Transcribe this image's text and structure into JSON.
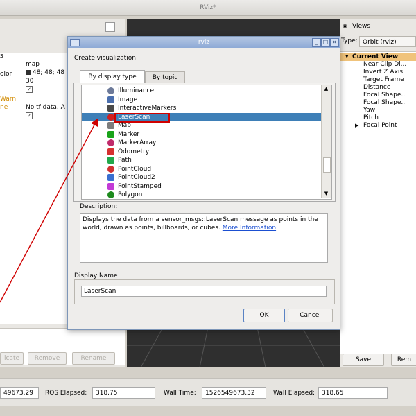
{
  "window": {
    "title": "RViz*"
  },
  "left_panel": {
    "partial_labels": [
      "s",
      "olor",
      "Warn",
      "ne"
    ],
    "values": [
      "map",
      "48; 48; 48",
      "30",
      "No tf data.  A"
    ],
    "buttons": [
      "icate",
      "Remove",
      "Rename"
    ]
  },
  "views_panel": {
    "title": "Views",
    "type_label": "Type:",
    "type_value": "Orbit (rviz)",
    "tree": {
      "current": "Current View",
      "items": [
        "Near Clip Di...",
        "Invert Z Axis",
        "Target Frame",
        "Distance",
        "Focal Shape...",
        "Focal Shape...",
        "Yaw",
        "Pitch",
        "Focal Point"
      ]
    },
    "save_label": "Save",
    "remove_label": "Rem"
  },
  "status_bar": {
    "ros_time_value": "49673.29",
    "ros_elapsed_label": "ROS Elapsed:",
    "ros_elapsed_value": "318.75",
    "wall_time_label": "Wall Time:",
    "wall_time_value": "1526549673.32",
    "wall_elapsed_label": "Wall Elapsed:",
    "wall_elapsed_value": "318.65"
  },
  "dialog": {
    "title": "rviz",
    "heading": "Create visualization",
    "tabs": [
      "By display type",
      "By topic"
    ],
    "list_items": [
      {
        "label": "Illuminance",
        "icon": "illuminance-icon",
        "color": "#6d7a99"
      },
      {
        "label": "Image",
        "icon": "image-icon",
        "color": "#4b6fae"
      },
      {
        "label": "InteractiveMarkers",
        "icon": "interactive-markers-icon",
        "color": "#4a4a4a"
      },
      {
        "label": "LaserScan",
        "icon": "laserscan-icon",
        "color": "#d02020",
        "selected": true
      },
      {
        "label": "Map",
        "icon": "map-icon",
        "color": "#7d7d7d"
      },
      {
        "label": "Marker",
        "icon": "marker-icon",
        "color": "#19a319"
      },
      {
        "label": "MarkerArray",
        "icon": "marker-array-icon",
        "color": "#c02a6a"
      },
      {
        "label": "Odometry",
        "icon": "odometry-icon",
        "color": "#d63030"
      },
      {
        "label": "Path",
        "icon": "path-icon",
        "color": "#21a84a"
      },
      {
        "label": "PointCloud",
        "icon": "pointcloud-icon",
        "color": "#d03030"
      },
      {
        "label": "PointCloud2",
        "icon": "pointcloud2-icon",
        "color": "#3a6fd0"
      },
      {
        "label": "PointStamped",
        "icon": "pointstamped-icon",
        "color": "#c23bd6"
      },
      {
        "label": "Polygon",
        "icon": "polygon-icon",
        "color": "#1d8a1d"
      }
    ],
    "description_heading": "Description:",
    "description_text": "Displays the data from a sensor_msgs::LaserScan message as points in the world, drawn as points, billboards, or cubes.",
    "description_link": "More Information",
    "description_period": ".",
    "display_name_heading": "Display Name",
    "display_name_value": "LaserScan",
    "ok_label": "OK",
    "cancel_label": "Cancel"
  },
  "colors": {
    "selection": "#3e7fb7",
    "annotation": "#d00000",
    "current_view": "#f0c37b"
  }
}
